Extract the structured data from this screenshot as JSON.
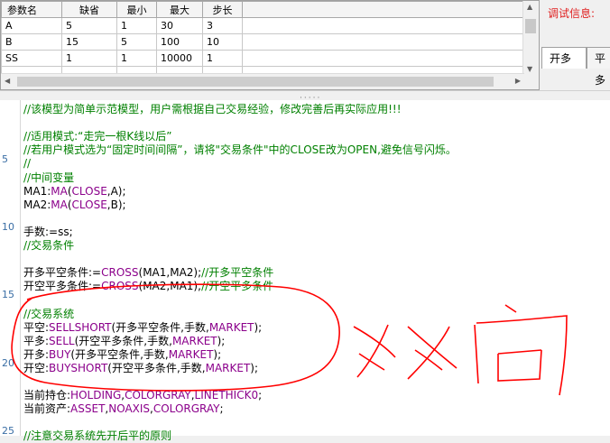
{
  "params": {
    "headers": [
      "参数名",
      "缺省",
      "最小",
      "最大",
      "步长"
    ],
    "rows": [
      [
        "A",
        "5",
        "1",
        "30",
        "3"
      ],
      [
        "B",
        "15",
        "5",
        "100",
        "10"
      ],
      [
        "SS",
        "1",
        "1",
        "10000",
        "1"
      ]
    ]
  },
  "debug": {
    "label": "调试信息:",
    "tabs": [
      "开多",
      "平多"
    ]
  },
  "code": {
    "line_numbers": [
      "5",
      "10",
      "15",
      "20",
      "25"
    ],
    "lines": [
      [
        {
          "t": "//该模型为简单示范模型，用户需根据自己交易经验，修改完善后再实际应用!!!",
          "c": "cm"
        }
      ],
      [],
      [
        {
          "t": "//适用模式:“走完一根K线以后”",
          "c": "cm"
        }
      ],
      [
        {
          "t": "//若用户模式选为“固定时间间隔”，请将\"交易条件\"中的CLOSE改为OPEN,避免信号闪烁。",
          "c": "cm"
        }
      ],
      [
        {
          "t": "//",
          "c": "cm"
        }
      ],
      [
        {
          "t": "//中间变量",
          "c": "cm"
        }
      ],
      [
        {
          "t": "MA1:",
          "c": "pl"
        },
        {
          "t": "MA",
          "c": "kw"
        },
        {
          "t": "(",
          "c": "pl"
        },
        {
          "t": "CLOSE",
          "c": "kw"
        },
        {
          "t": ",A);",
          "c": "pl"
        }
      ],
      [
        {
          "t": "MA2:",
          "c": "pl"
        },
        {
          "t": "MA",
          "c": "kw"
        },
        {
          "t": "(",
          "c": "pl"
        },
        {
          "t": "CLOSE",
          "c": "kw"
        },
        {
          "t": ",B);",
          "c": "pl"
        }
      ],
      [],
      [
        {
          "t": "手数:=ss;",
          "c": "pl"
        }
      ],
      [
        {
          "t": "//交易条件",
          "c": "cm"
        }
      ],
      [],
      [
        {
          "t": "开多平空条件:=",
          "c": "pl"
        },
        {
          "t": "CROSS",
          "c": "kw"
        },
        {
          "t": "(MA1,MA2);",
          "c": "pl"
        },
        {
          "t": "//开多平空条件",
          "c": "cm"
        }
      ],
      [
        {
          "t": "开空平多条件:=",
          "c": "pl"
        },
        {
          "t": "CROSS",
          "c": "kw"
        },
        {
          "t": "(MA2,MA1);",
          "c": "pl"
        },
        {
          "t": "//开空平多条件",
          "c": "cm"
        }
      ],
      [],
      [
        {
          "t": "//交易系统",
          "c": "cm"
        }
      ],
      [
        {
          "t": "平空:",
          "c": "pl"
        },
        {
          "t": "SELLSHORT",
          "c": "kw"
        },
        {
          "t": "(开多平空条件,手数,",
          "c": "pl"
        },
        {
          "t": "MARKET",
          "c": "kw"
        },
        {
          "t": ");",
          "c": "pl"
        }
      ],
      [
        {
          "t": "平多:",
          "c": "pl"
        },
        {
          "t": "SELL",
          "c": "kw"
        },
        {
          "t": "(开空平多条件,手数,",
          "c": "pl"
        },
        {
          "t": "MARKET",
          "c": "kw"
        },
        {
          "t": ");",
          "c": "pl"
        }
      ],
      [
        {
          "t": "开多:",
          "c": "pl"
        },
        {
          "t": "BUY",
          "c": "kw"
        },
        {
          "t": "(开多平空条件,手数,",
          "c": "pl"
        },
        {
          "t": "MARKET",
          "c": "kw"
        },
        {
          "t": ");",
          "c": "pl"
        }
      ],
      [
        {
          "t": "开空:",
          "c": "pl"
        },
        {
          "t": "BUYSHORT",
          "c": "kw"
        },
        {
          "t": "(开空平多条件,手数,",
          "c": "pl"
        },
        {
          "t": "MARKET",
          "c": "kw"
        },
        {
          "t": ");",
          "c": "pl"
        }
      ],
      [],
      [
        {
          "t": "当前持仓:",
          "c": "pl"
        },
        {
          "t": "HOLDING",
          "c": "kw"
        },
        {
          "t": ",",
          "c": "pl"
        },
        {
          "t": "COLORGRAY",
          "c": "kw"
        },
        {
          "t": ",",
          "c": "pl"
        },
        {
          "t": "LINETHICK0",
          "c": "kw"
        },
        {
          "t": ";",
          "c": "pl"
        }
      ],
      [
        {
          "t": "当前资产:",
          "c": "pl"
        },
        {
          "t": "ASSET",
          "c": "kw"
        },
        {
          "t": ",",
          "c": "pl"
        },
        {
          "t": "NOAXIS",
          "c": "kw"
        },
        {
          "t": ",",
          "c": "pl"
        },
        {
          "t": "COLORGRAY",
          "c": "kw"
        },
        {
          "t": ";",
          "c": "pl"
        }
      ],
      [],
      [
        {
          "t": "//注意交易系统先开后平的原则",
          "c": "cm"
        }
      ]
    ]
  },
  "colors": {
    "comment": "#008000",
    "keyword": "#8b008b",
    "line_number": "#3a6ea5",
    "annotation": "#ff0000"
  }
}
